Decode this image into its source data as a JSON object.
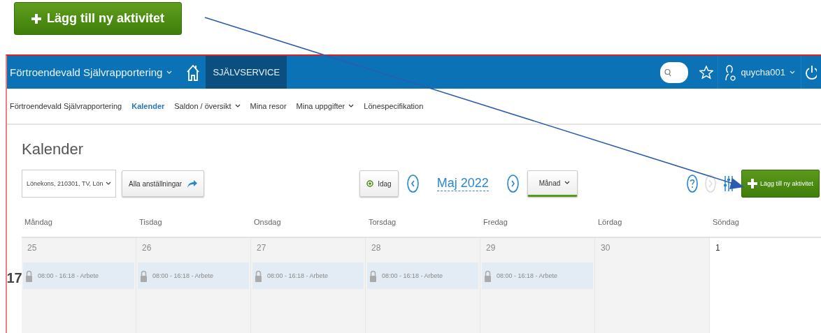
{
  "callout": {
    "label": "Lägg till ny aktivitet"
  },
  "header": {
    "app_title": "Förtroendevald Självrapportering",
    "tabs": [
      {
        "label": "SJÄLVSERVICE",
        "selected": true
      }
    ],
    "user": "quycha001"
  },
  "nav": [
    {
      "label": "Förtroendevald Självrapportering",
      "selected": false,
      "has_menu": false
    },
    {
      "label": "Kalender",
      "selected": true,
      "has_menu": false
    },
    {
      "label": "Saldon / översikt",
      "selected": false,
      "has_menu": true
    },
    {
      "label": "Mina resor",
      "selected": false,
      "has_menu": false
    },
    {
      "label": "Mina uppgifter",
      "selected": false,
      "has_menu": true
    },
    {
      "label": "Lönespecifikation",
      "selected": false,
      "has_menu": false
    }
  ],
  "page_title": "Kalender",
  "toolbar": {
    "employment": "Lönekons, 210301, TV, Lön",
    "all_employments": "Alla anställningar",
    "today": "Idag",
    "month": "Maj 2022",
    "view": "Månad",
    "add": "Lägg till ny aktivitet"
  },
  "calendar": {
    "weekdays": [
      "Måndag",
      "Tisdag",
      "Onsdag",
      "Torsdag",
      "Fredag",
      "Lördag",
      "Söndag"
    ],
    "weeks": [
      {
        "number": "17",
        "days": [
          {
            "date": "25",
            "in_month": false,
            "events": [
              {
                "label": "08:00 - 16:18 - Arbete",
                "locked": true
              }
            ]
          },
          {
            "date": "26",
            "in_month": false,
            "events": [
              {
                "label": "08:00 - 16:18 - Arbete",
                "locked": true
              }
            ]
          },
          {
            "date": "27",
            "in_month": false,
            "events": [
              {
                "label": "08:00 - 16:18 - Arbete",
                "locked": true
              }
            ]
          },
          {
            "date": "28",
            "in_month": false,
            "events": [
              {
                "label": "08:00 - 16:18 - Arbete",
                "locked": true
              }
            ]
          },
          {
            "date": "29",
            "in_month": false,
            "events": [
              {
                "label": "08:00 - 16:18 - Arbete",
                "locked": true
              }
            ]
          },
          {
            "date": "30",
            "in_month": false
          },
          {
            "date": "1",
            "in_month": true
          }
        ]
      }
    ]
  }
}
